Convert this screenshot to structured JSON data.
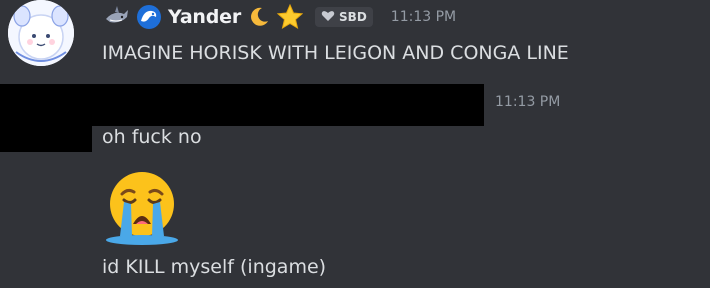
{
  "author": {
    "name": "Yander",
    "tag": "SBD"
  },
  "messages": [
    {
      "timestamp": "11:13 PM",
      "text": "IMAGINE HORISK WITH LEIGON AND CONGA LINE"
    },
    {
      "timestamp": "11:13 PM",
      "text": "oh fuck no"
    },
    {
      "text": "id KILL myself (ingame)",
      "emoji": "loudly-crying-face"
    }
  ],
  "icons": {
    "decorations": [
      "shark-icon",
      "wave-icon",
      "crescent-moon-icon",
      "star-icon"
    ],
    "tag_icon": "heart-icon"
  },
  "colors": {
    "background": "#313338",
    "username": "#f2f3f5",
    "text": "#dbdee1",
    "muted": "#949ba4",
    "tag_bg": "#3f4147"
  }
}
